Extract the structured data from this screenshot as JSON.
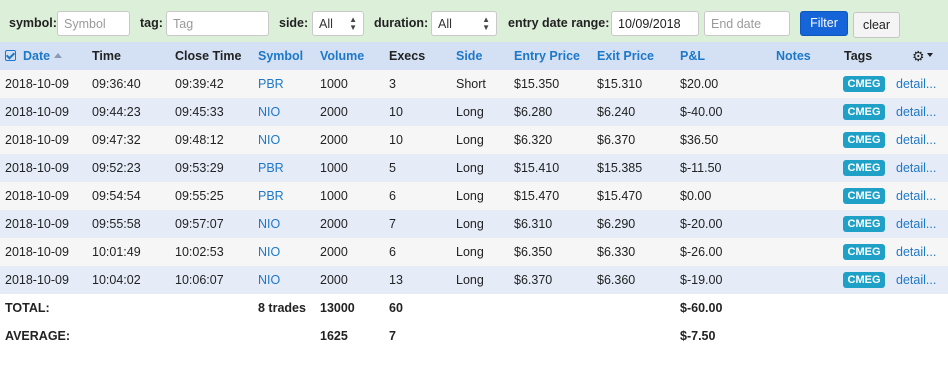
{
  "filters": {
    "symbol_label": "symbol:",
    "symbol_placeholder": "Symbol",
    "tag_label": "tag:",
    "tag_placeholder": "Tag",
    "side_label": "side:",
    "side_value": "All",
    "duration_label": "duration:",
    "duration_value": "All",
    "entry_date_label": "entry date range:",
    "start_date_value": "10/09/2018",
    "end_date_placeholder": "End date",
    "filter_button": "Filter",
    "clear_button": "clear"
  },
  "columns": {
    "date": "Date",
    "time": "Time",
    "close_time": "Close Time",
    "symbol": "Symbol",
    "volume": "Volume",
    "execs": "Execs",
    "side": "Side",
    "entry_price": "Entry Price",
    "exit_price": "Exit Price",
    "pnl": "P&L",
    "notes": "Notes",
    "tags": "Tags"
  },
  "rows": [
    {
      "date": "2018-10-09",
      "time": "09:36:40",
      "close_time": "09:39:42",
      "symbol": "PBR",
      "volume": "1000",
      "execs": "3",
      "side": "Short",
      "entry_price": "$15.350",
      "exit_price": "$15.310",
      "pnl": "$20.00",
      "tag": "CMEG",
      "detail": "detail..."
    },
    {
      "date": "2018-10-09",
      "time": "09:44:23",
      "close_time": "09:45:33",
      "symbol": "NIO",
      "volume": "2000",
      "execs": "10",
      "side": "Long",
      "entry_price": "$6.280",
      "exit_price": "$6.240",
      "pnl": "$-40.00",
      "tag": "CMEG",
      "detail": "detail..."
    },
    {
      "date": "2018-10-09",
      "time": "09:47:32",
      "close_time": "09:48:12",
      "symbol": "NIO",
      "volume": "2000",
      "execs": "10",
      "side": "Long",
      "entry_price": "$6.320",
      "exit_price": "$6.370",
      "pnl": "$36.50",
      "tag": "CMEG",
      "detail": "detail..."
    },
    {
      "date": "2018-10-09",
      "time": "09:52:23",
      "close_time": "09:53:29",
      "symbol": "PBR",
      "volume": "1000",
      "execs": "5",
      "side": "Long",
      "entry_price": "$15.410",
      "exit_price": "$15.385",
      "pnl": "$-11.50",
      "tag": "CMEG",
      "detail": "detail..."
    },
    {
      "date": "2018-10-09",
      "time": "09:54:54",
      "close_time": "09:55:25",
      "symbol": "PBR",
      "volume": "1000",
      "execs": "6",
      "side": "Long",
      "entry_price": "$15.470",
      "exit_price": "$15.470",
      "pnl": "$0.00",
      "tag": "CMEG",
      "detail": "detail..."
    },
    {
      "date": "2018-10-09",
      "time": "09:55:58",
      "close_time": "09:57:07",
      "symbol": "NIO",
      "volume": "2000",
      "execs": "7",
      "side": "Long",
      "entry_price": "$6.310",
      "exit_price": "$6.290",
      "pnl": "$-20.00",
      "tag": "CMEG",
      "detail": "detail..."
    },
    {
      "date": "2018-10-09",
      "time": "10:01:49",
      "close_time": "10:02:53",
      "symbol": "NIO",
      "volume": "2000",
      "execs": "6",
      "side": "Long",
      "entry_price": "$6.350",
      "exit_price": "$6.330",
      "pnl": "$-26.00",
      "tag": "CMEG",
      "detail": "detail..."
    },
    {
      "date": "2018-10-09",
      "time": "10:04:02",
      "close_time": "10:06:07",
      "symbol": "NIO",
      "volume": "2000",
      "execs": "13",
      "side": "Long",
      "entry_price": "$6.370",
      "exit_price": "$6.360",
      "pnl": "$-19.00",
      "tag": "CMEG",
      "detail": "detail..."
    }
  ],
  "total": {
    "label": "TOTAL:",
    "trades": "8 trades",
    "volume": "13000",
    "execs": "60",
    "pnl": "$-60.00"
  },
  "average": {
    "label": "AVERAGE:",
    "volume": "1625",
    "execs": "7",
    "pnl": "$-7.50"
  },
  "colors": {
    "filter_bg": "#dcefd9",
    "header_bg": "#d4e1f5",
    "link": "#1e78c8",
    "tag_badge": "#1ea0c7",
    "filter_button": "#1565d8"
  }
}
